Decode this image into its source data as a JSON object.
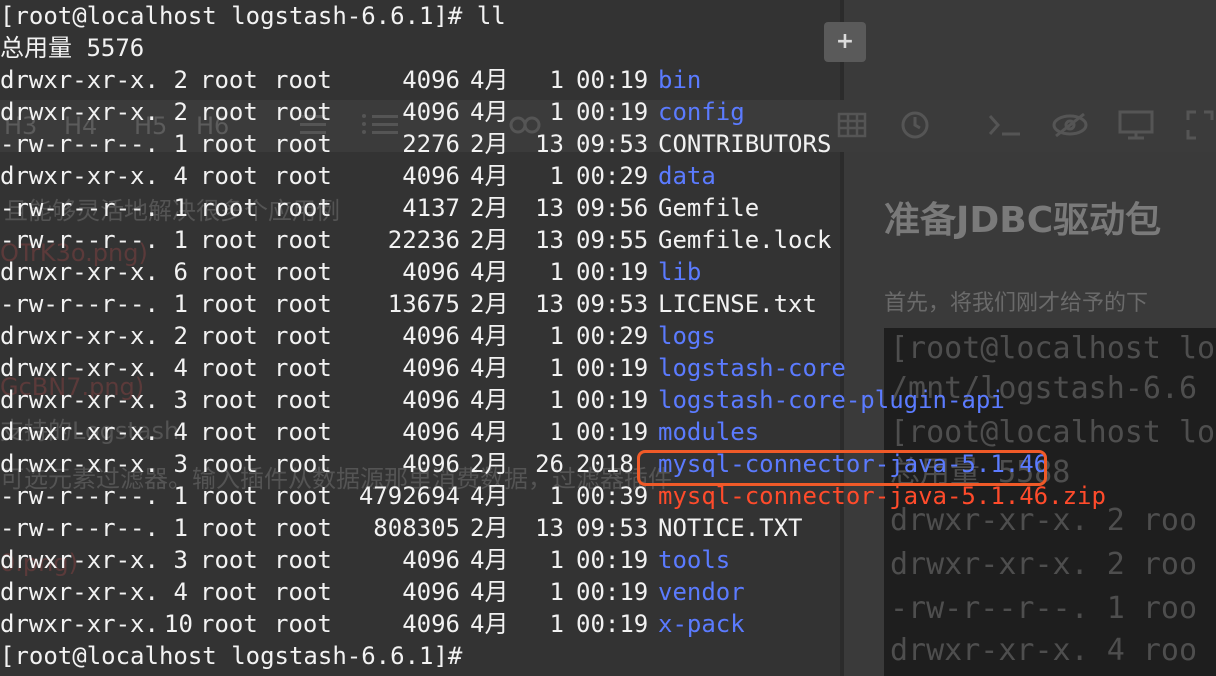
{
  "background_editor": {
    "toolbar_items": [
      "H3",
      "H4",
      "H5",
      "H6"
    ],
    "left_text": [
      "且能够灵活地解决很多个应用例",
      "OTrK3o.png)",
      "GcBN7.png)",
      "支持的Logstash",
      "可选元素过滤器。输入插件从数据源那里消费数据，过滤器插件",
      "0.png)"
    ],
    "right_heading": "准备JDBC驱动包",
    "right_paragraph": "首先，将我们刚才给予的下",
    "right_code_lines": [
      "[root@localhost lo",
      "/mnt/logstash-6.6",
      "[root@localhost lo",
      "总用量 5588",
      "drwxr-xr-x.  2 roo",
      "drwxr-xr-x.  2 roo",
      "-rw-r--r--.  1 roo",
      "drwxr-xr-x.  4 roo"
    ],
    "plus_label": "+"
  },
  "terminal": {
    "prompt_top": "[root@localhost logstash-6.6.1]# ll",
    "total_line": "总用量 5576",
    "entries": [
      {
        "perms": "drwxr-xr-x.",
        "links": "2",
        "owner": "root",
        "group": "root",
        "size": "4096",
        "month": "4月",
        "day": "1",
        "time": "00:19",
        "name": "bin",
        "kind": "dir"
      },
      {
        "perms": "drwxr-xr-x.",
        "links": "2",
        "owner": "root",
        "group": "root",
        "size": "4096",
        "month": "4月",
        "day": "1",
        "time": "00:19",
        "name": "config",
        "kind": "dir"
      },
      {
        "perms": "-rw-r--r--.",
        "links": "1",
        "owner": "root",
        "group": "root",
        "size": "2276",
        "month": "2月",
        "day": "13",
        "time": "09:53",
        "name": "CONTRIBUTORS",
        "kind": "file"
      },
      {
        "perms": "drwxr-xr-x.",
        "links": "4",
        "owner": "root",
        "group": "root",
        "size": "4096",
        "month": "4月",
        "day": "1",
        "time": "00:29",
        "name": "data",
        "kind": "dir"
      },
      {
        "perms": "-rw-r--r--.",
        "links": "1",
        "owner": "root",
        "group": "root",
        "size": "4137",
        "month": "2月",
        "day": "13",
        "time": "09:56",
        "name": "Gemfile",
        "kind": "file"
      },
      {
        "perms": "-rw-r--r--.",
        "links": "1",
        "owner": "root",
        "group": "root",
        "size": "22236",
        "month": "2月",
        "day": "13",
        "time": "09:55",
        "name": "Gemfile.lock",
        "kind": "file"
      },
      {
        "perms": "drwxr-xr-x.",
        "links": "6",
        "owner": "root",
        "group": "root",
        "size": "4096",
        "month": "4月",
        "day": "1",
        "time": "00:19",
        "name": "lib",
        "kind": "dir"
      },
      {
        "perms": "-rw-r--r--.",
        "links": "1",
        "owner": "root",
        "group": "root",
        "size": "13675",
        "month": "2月",
        "day": "13",
        "time": "09:53",
        "name": "LICENSE.txt",
        "kind": "file"
      },
      {
        "perms": "drwxr-xr-x.",
        "links": "2",
        "owner": "root",
        "group": "root",
        "size": "4096",
        "month": "4月",
        "day": "1",
        "time": "00:29",
        "name": "logs",
        "kind": "dir"
      },
      {
        "perms": "drwxr-xr-x.",
        "links": "4",
        "owner": "root",
        "group": "root",
        "size": "4096",
        "month": "4月",
        "day": "1",
        "time": "00:19",
        "name": "logstash-core",
        "kind": "dir"
      },
      {
        "perms": "drwxr-xr-x.",
        "links": "3",
        "owner": "root",
        "group": "root",
        "size": "4096",
        "month": "4月",
        "day": "1",
        "time": "00:19",
        "name": "logstash-core-plugin-api",
        "kind": "dir"
      },
      {
        "perms": "drwxr-xr-x.",
        "links": "4",
        "owner": "root",
        "group": "root",
        "size": "4096",
        "month": "4月",
        "day": "1",
        "time": "00:19",
        "name": "modules",
        "kind": "dir"
      },
      {
        "perms": "drwxr-xr-x.",
        "links": "3",
        "owner": "root",
        "group": "root",
        "size": "4096",
        "month": "2月",
        "day": "26",
        "time": "2018",
        "name": "mysql-connector-java-5.1.46",
        "kind": "dir",
        "highlighted": true
      },
      {
        "perms": "-rw-r--r--.",
        "links": "1",
        "owner": "root",
        "group": "root",
        "size": "4792694",
        "month": "4月",
        "day": "1",
        "time": "00:39",
        "name": "mysql-connector-java-5.1.46.zip",
        "kind": "zip"
      },
      {
        "perms": "-rw-r--r--.",
        "links": "1",
        "owner": "root",
        "group": "root",
        "size": "808305",
        "month": "2月",
        "day": "13",
        "time": "09:53",
        "name": "NOTICE.TXT",
        "kind": "file"
      },
      {
        "perms": "drwxr-xr-x.",
        "links": "3",
        "owner": "root",
        "group": "root",
        "size": "4096",
        "month": "4月",
        "day": "1",
        "time": "00:19",
        "name": "tools",
        "kind": "dir"
      },
      {
        "perms": "drwxr-xr-x.",
        "links": "4",
        "owner": "root",
        "group": "root",
        "size": "4096",
        "month": "4月",
        "day": "1",
        "time": "00:19",
        "name": "vendor",
        "kind": "dir"
      },
      {
        "perms": "drwxr-xr-x.",
        "links": "10",
        "owner": "root",
        "group": "root",
        "size": "4096",
        "month": "4月",
        "day": "1",
        "time": "00:19",
        "name": "x-pack",
        "kind": "dir"
      }
    ],
    "prompt_bottom": "[root@localhost logstash-6.6.1]#"
  },
  "colors": {
    "directory": "#5b7bff",
    "regular_file": "#f2f2f2",
    "archive": "#ff4b2b",
    "highlight_box": "#f05a28",
    "terminal_text": "#f2f2f2"
  }
}
